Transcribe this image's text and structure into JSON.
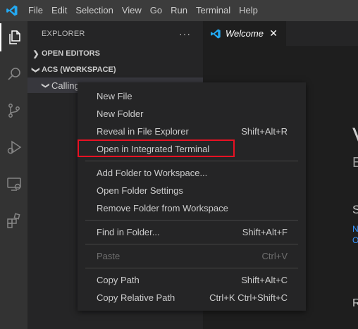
{
  "menubar": {
    "items": [
      "File",
      "Edit",
      "Selection",
      "View",
      "Go",
      "Run",
      "Terminal",
      "Help"
    ]
  },
  "activity": {
    "icons": [
      "files-icon",
      "search-icon",
      "source-control-icon",
      "run-debug-icon",
      "remote-explorer-icon",
      "extensions-icon"
    ]
  },
  "sidebar": {
    "title": "EXPLORER",
    "more": "···",
    "open_editors": "OPEN EDITORS",
    "workspace": "ACS (WORKSPACE)",
    "folder": "Calling"
  },
  "editor": {
    "tab_label": "Welcome",
    "close": "✕",
    "partial_title": "V",
    "partial_subtitle": "E",
    "partial_section": "S",
    "partial_link1": "N",
    "partial_link2": "O",
    "partial_bottom": "R"
  },
  "context_menu": {
    "items": [
      {
        "label": "New File",
        "kb": ""
      },
      {
        "label": "New Folder",
        "kb": ""
      },
      {
        "label": "Reveal in File Explorer",
        "kb": "Shift+Alt+R"
      },
      {
        "label": "Open in Integrated Terminal",
        "kb": ""
      },
      {
        "label": "Add Folder to Workspace...",
        "kb": ""
      },
      {
        "label": "Open Folder Settings",
        "kb": ""
      },
      {
        "label": "Remove Folder from Workspace",
        "kb": ""
      },
      {
        "label": "Find in Folder...",
        "kb": "Shift+Alt+F"
      },
      {
        "label": "Paste",
        "kb": "Ctrl+V"
      },
      {
        "label": "Copy Path",
        "kb": "Shift+Alt+C"
      },
      {
        "label": "Copy Relative Path",
        "kb": "Ctrl+K Ctrl+Shift+C"
      }
    ]
  },
  "colors": {
    "accent": "#007acc",
    "highlight_border": "#e81123"
  }
}
